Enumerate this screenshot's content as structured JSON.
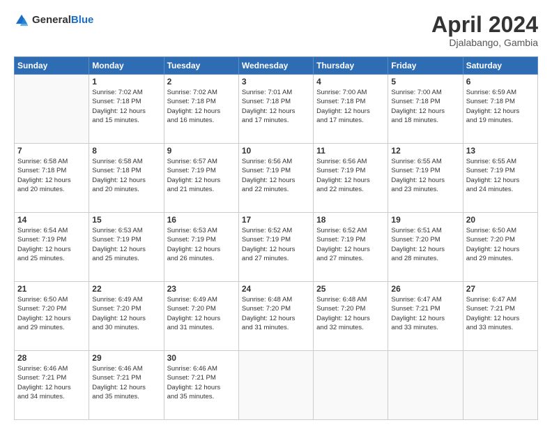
{
  "header": {
    "logo_general": "General",
    "logo_blue": "Blue",
    "title": "April 2024",
    "location": "Djalabango, Gambia"
  },
  "weekdays": [
    "Sunday",
    "Monday",
    "Tuesday",
    "Wednesday",
    "Thursday",
    "Friday",
    "Saturday"
  ],
  "weeks": [
    [
      {
        "day": "",
        "info": ""
      },
      {
        "day": "1",
        "info": "Sunrise: 7:02 AM\nSunset: 7:18 PM\nDaylight: 12 hours\nand 15 minutes."
      },
      {
        "day": "2",
        "info": "Sunrise: 7:02 AM\nSunset: 7:18 PM\nDaylight: 12 hours\nand 16 minutes."
      },
      {
        "day": "3",
        "info": "Sunrise: 7:01 AM\nSunset: 7:18 PM\nDaylight: 12 hours\nand 17 minutes."
      },
      {
        "day": "4",
        "info": "Sunrise: 7:00 AM\nSunset: 7:18 PM\nDaylight: 12 hours\nand 17 minutes."
      },
      {
        "day": "5",
        "info": "Sunrise: 7:00 AM\nSunset: 7:18 PM\nDaylight: 12 hours\nand 18 minutes."
      },
      {
        "day": "6",
        "info": "Sunrise: 6:59 AM\nSunset: 7:18 PM\nDaylight: 12 hours\nand 19 minutes."
      }
    ],
    [
      {
        "day": "7",
        "info": "Sunrise: 6:58 AM\nSunset: 7:18 PM\nDaylight: 12 hours\nand 20 minutes."
      },
      {
        "day": "8",
        "info": "Sunrise: 6:58 AM\nSunset: 7:18 PM\nDaylight: 12 hours\nand 20 minutes."
      },
      {
        "day": "9",
        "info": "Sunrise: 6:57 AM\nSunset: 7:19 PM\nDaylight: 12 hours\nand 21 minutes."
      },
      {
        "day": "10",
        "info": "Sunrise: 6:56 AM\nSunset: 7:19 PM\nDaylight: 12 hours\nand 22 minutes."
      },
      {
        "day": "11",
        "info": "Sunrise: 6:56 AM\nSunset: 7:19 PM\nDaylight: 12 hours\nand 22 minutes."
      },
      {
        "day": "12",
        "info": "Sunrise: 6:55 AM\nSunset: 7:19 PM\nDaylight: 12 hours\nand 23 minutes."
      },
      {
        "day": "13",
        "info": "Sunrise: 6:55 AM\nSunset: 7:19 PM\nDaylight: 12 hours\nand 24 minutes."
      }
    ],
    [
      {
        "day": "14",
        "info": "Sunrise: 6:54 AM\nSunset: 7:19 PM\nDaylight: 12 hours\nand 25 minutes."
      },
      {
        "day": "15",
        "info": "Sunrise: 6:53 AM\nSunset: 7:19 PM\nDaylight: 12 hours\nand 25 minutes."
      },
      {
        "day": "16",
        "info": "Sunrise: 6:53 AM\nSunset: 7:19 PM\nDaylight: 12 hours\nand 26 minutes."
      },
      {
        "day": "17",
        "info": "Sunrise: 6:52 AM\nSunset: 7:19 PM\nDaylight: 12 hours\nand 27 minutes."
      },
      {
        "day": "18",
        "info": "Sunrise: 6:52 AM\nSunset: 7:19 PM\nDaylight: 12 hours\nand 27 minutes."
      },
      {
        "day": "19",
        "info": "Sunrise: 6:51 AM\nSunset: 7:20 PM\nDaylight: 12 hours\nand 28 minutes."
      },
      {
        "day": "20",
        "info": "Sunrise: 6:50 AM\nSunset: 7:20 PM\nDaylight: 12 hours\nand 29 minutes."
      }
    ],
    [
      {
        "day": "21",
        "info": "Sunrise: 6:50 AM\nSunset: 7:20 PM\nDaylight: 12 hours\nand 29 minutes."
      },
      {
        "day": "22",
        "info": "Sunrise: 6:49 AM\nSunset: 7:20 PM\nDaylight: 12 hours\nand 30 minutes."
      },
      {
        "day": "23",
        "info": "Sunrise: 6:49 AM\nSunset: 7:20 PM\nDaylight: 12 hours\nand 31 minutes."
      },
      {
        "day": "24",
        "info": "Sunrise: 6:48 AM\nSunset: 7:20 PM\nDaylight: 12 hours\nand 31 minutes."
      },
      {
        "day": "25",
        "info": "Sunrise: 6:48 AM\nSunset: 7:20 PM\nDaylight: 12 hours\nand 32 minutes."
      },
      {
        "day": "26",
        "info": "Sunrise: 6:47 AM\nSunset: 7:21 PM\nDaylight: 12 hours\nand 33 minutes."
      },
      {
        "day": "27",
        "info": "Sunrise: 6:47 AM\nSunset: 7:21 PM\nDaylight: 12 hours\nand 33 minutes."
      }
    ],
    [
      {
        "day": "28",
        "info": "Sunrise: 6:46 AM\nSunset: 7:21 PM\nDaylight: 12 hours\nand 34 minutes."
      },
      {
        "day": "29",
        "info": "Sunrise: 6:46 AM\nSunset: 7:21 PM\nDaylight: 12 hours\nand 35 minutes."
      },
      {
        "day": "30",
        "info": "Sunrise: 6:46 AM\nSunset: 7:21 PM\nDaylight: 12 hours\nand 35 minutes."
      },
      {
        "day": "",
        "info": ""
      },
      {
        "day": "",
        "info": ""
      },
      {
        "day": "",
        "info": ""
      },
      {
        "day": "",
        "info": ""
      }
    ]
  ]
}
